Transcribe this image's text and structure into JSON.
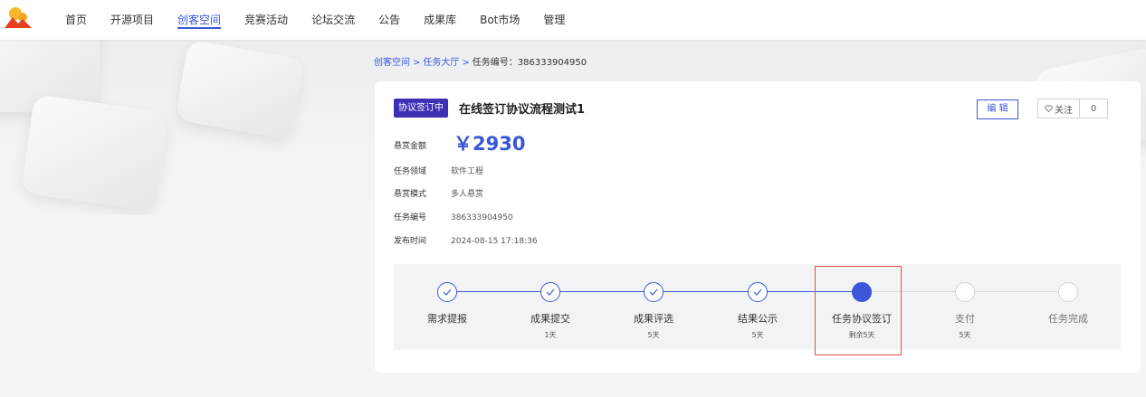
{
  "nav": {
    "items": [
      "首页",
      "开源项目",
      "创客空间",
      "竞赛活动",
      "论坛交流",
      "公告",
      "成果库",
      "Bot市场",
      "管理"
    ],
    "active_index": 2
  },
  "breadcrumb": {
    "items": [
      "创客空间",
      "任务大厅"
    ],
    "separator": ">",
    "current": "任务编号：386333904950"
  },
  "task": {
    "status_badge": "协议签订中",
    "title": "在线签订协议流程测试1",
    "reward_label": "悬赏金额",
    "reward_value": "￥2930",
    "fields": [
      {
        "label": "任务领域",
        "value": "软件工程"
      },
      {
        "label": "悬赏模式",
        "value": "多人悬赏"
      },
      {
        "label": "任务编号",
        "value": "386333904950"
      },
      {
        "label": "发布时间",
        "value": "2024-08-15 17:18:36"
      }
    ]
  },
  "actions": {
    "edit_label": "编 辑",
    "follow_label": "关注",
    "follow_count": "0"
  },
  "steps": [
    {
      "label": "需求提报",
      "sub": "",
      "state": "done"
    },
    {
      "label": "成果提交",
      "sub": "1天",
      "state": "done"
    },
    {
      "label": "成果评选",
      "sub": "5天",
      "state": "done"
    },
    {
      "label": "结果公示",
      "sub": "5天",
      "state": "done"
    },
    {
      "label": "任务协议签订",
      "sub": "剩余5天",
      "state": "current"
    },
    {
      "label": "支付",
      "sub": "5天",
      "state": "future"
    },
    {
      "label": "任务完成",
      "sub": "",
      "state": "future"
    }
  ],
  "colors": {
    "accent": "#3a56d9",
    "badge": "#3f2fb5",
    "highlight": "#e0504d"
  }
}
